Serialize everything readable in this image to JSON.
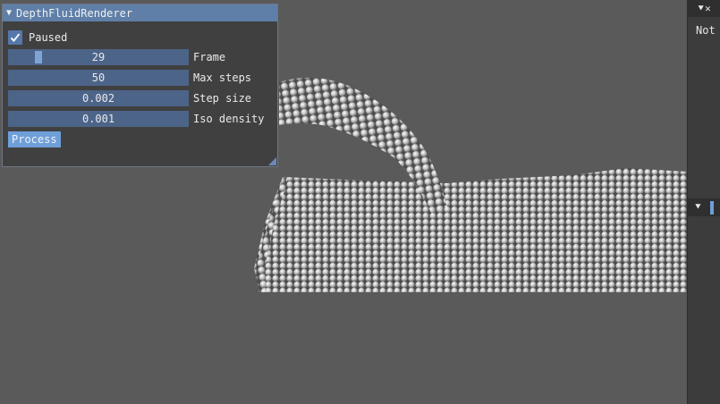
{
  "window": {
    "title": "DepthFluidRenderer",
    "paused_label": "Paused",
    "paused_checked": true,
    "frame": {
      "value": "29",
      "label": "Frame",
      "fraction": 0.15
    },
    "max_steps": {
      "value": "50",
      "label": "Max steps"
    },
    "step_size": {
      "value": "0.002",
      "label": "Step size"
    },
    "iso_density": {
      "value": "0.001",
      "label": "Iso density"
    },
    "process_label": "Process"
  },
  "side_panel": {
    "top_icons": "⯆✕",
    "text": "Not",
    "mid_icon": "⯆"
  },
  "colors": {
    "background": "#595959",
    "title_bar": "#5f7fa8",
    "slider": "#4d6489",
    "button": "#6f9fd9",
    "particles": "#c9c9c9"
  }
}
